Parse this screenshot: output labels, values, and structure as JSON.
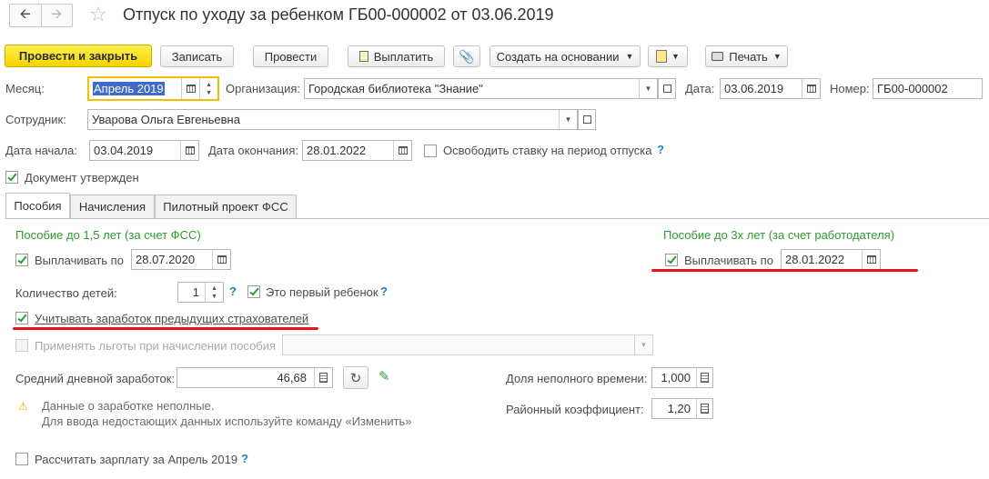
{
  "header": {
    "back_icon": "arrow-left-icon",
    "forward_icon": "arrow-right-icon",
    "star_icon": "star-outline-icon",
    "title": "Отпуск по уходу за ребенком ГБ00-000002 от 03.06.2019"
  },
  "toolbar": {
    "post_close": "Провести и закрыть",
    "write": "Записать",
    "post": "Провести",
    "pay": "Выплатить",
    "create_based": "Создать на основании",
    "print": "Печать"
  },
  "fields": {
    "month_label": "Месяц:",
    "month_value": "Апрель 2019",
    "org_label": "Организация:",
    "org_value": "Городская библиотека \"Знание\"",
    "date_label": "Дата:",
    "date_value": "03.06.2019",
    "number_label": "Номер:",
    "number_value": "ГБ00-000002",
    "employee_label": "Сотрудник:",
    "employee_value": "Уварова Ольга Евгеньевна",
    "start_label": "Дата начала:",
    "start_value": "03.04.2019",
    "end_label": "Дата окончания:",
    "end_value": "28.01.2022",
    "release_rate_label": "Освободить ставку на период отпуска",
    "approved_label": "Документ утвержден"
  },
  "tabs": [
    "Пособия",
    "Начисления",
    "Пилотный проект ФСС"
  ],
  "benefits": {
    "left_heading": "Пособие до 1,5 лет (за счет ФСС)",
    "right_heading": "Пособие до 3х лет (за счет работодателя)",
    "pay_until_label": "Выплачивать по",
    "pay_until_value": "28.07.2020",
    "pay_until_right_label": "Выплачивать по",
    "pay_until_right_value": "28.01.2022",
    "children_label": "Количество детей:",
    "children_value": "1",
    "first_child_label": "Это первый ребенок",
    "prev_insurers_label": "Учитывать заработок предыдущих страхователей",
    "apply_benefits_label": "Применять льготы при начислении пособия",
    "avg_earning_label": "Средний дневной заработок:",
    "avg_earning_value": "46,68",
    "part_time_label": "Доля неполного времени:",
    "part_time_value": "1,000",
    "district_coef_label": "Районный коэффициент:",
    "district_coef_value": "1,20",
    "warning_line1": "Данные о заработке неполные.",
    "warning_line2": "Для ввода недостающих данных используйте команду «Изменить»",
    "calc_salary_label": "Рассчитать зарплату за Апрель 2019"
  },
  "colors": {
    "primary_button": "#f5d300",
    "heading_green": "#2d9a2d",
    "help_blue": "#1e82c8",
    "annotation_red": "#e8161b"
  }
}
